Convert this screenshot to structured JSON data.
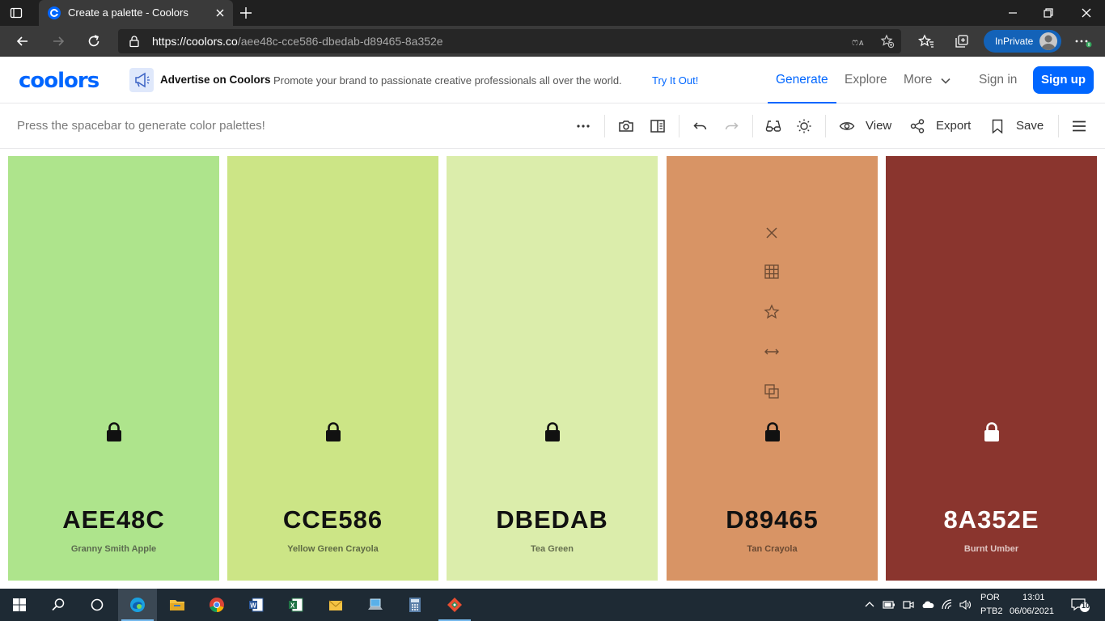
{
  "browser": {
    "tab_title": "Create a palette - Coolors",
    "url_host": "https://coolors.co",
    "url_path": "/aee48c-cce586-dbedab-d89465-8a352e",
    "inprivate_label": "InPrivate"
  },
  "header": {
    "logo": "coolors",
    "ad_title": "Advertise on Coolors",
    "ad_text": "Promote your brand to passionate creative professionals all over the world.",
    "ad_link": "Try It Out!",
    "nav": {
      "generate": "Generate",
      "explore": "Explore",
      "more": "More"
    },
    "sign_in": "Sign in",
    "sign_up": "Sign up",
    "accent": "#0066ff"
  },
  "toolbar": {
    "hint": "Press the spacebar to generate color palettes!",
    "view_label": "View",
    "export_label": "Export",
    "save_label": "Save"
  },
  "palette": [
    {
      "hex": "AEE48C",
      "name": "Granny Smith Apple",
      "color": "#AEE48C",
      "text_color": "#111111",
      "name_color": "#5b6b4f",
      "locked": false,
      "show_tools": false
    },
    {
      "hex": "CCE586",
      "name": "Yellow Green Crayola",
      "color": "#CCE586",
      "text_color": "#111111",
      "name_color": "#5f6b45",
      "locked": false,
      "show_tools": false
    },
    {
      "hex": "DBEDAB",
      "name": "Tea Green",
      "color": "#DBEDAB",
      "text_color": "#111111",
      "name_color": "#66704f",
      "locked": false,
      "show_tools": false
    },
    {
      "hex": "D89465",
      "name": "Tan Crayola",
      "color": "#D89465",
      "text_color": "#111111",
      "name_color": "#6b4a33",
      "locked": false,
      "show_tools": true
    },
    {
      "hex": "8A352E",
      "name": "Burnt Umber",
      "color": "#8A352E",
      "text_color": "#ffffff",
      "name_color": "#e0c6c3",
      "locked": false,
      "show_tools": false
    }
  ],
  "taskbar": {
    "language": "POR",
    "layout": "PTB2",
    "time": "13:01",
    "date": "06/06/2021",
    "notifications": "10"
  }
}
